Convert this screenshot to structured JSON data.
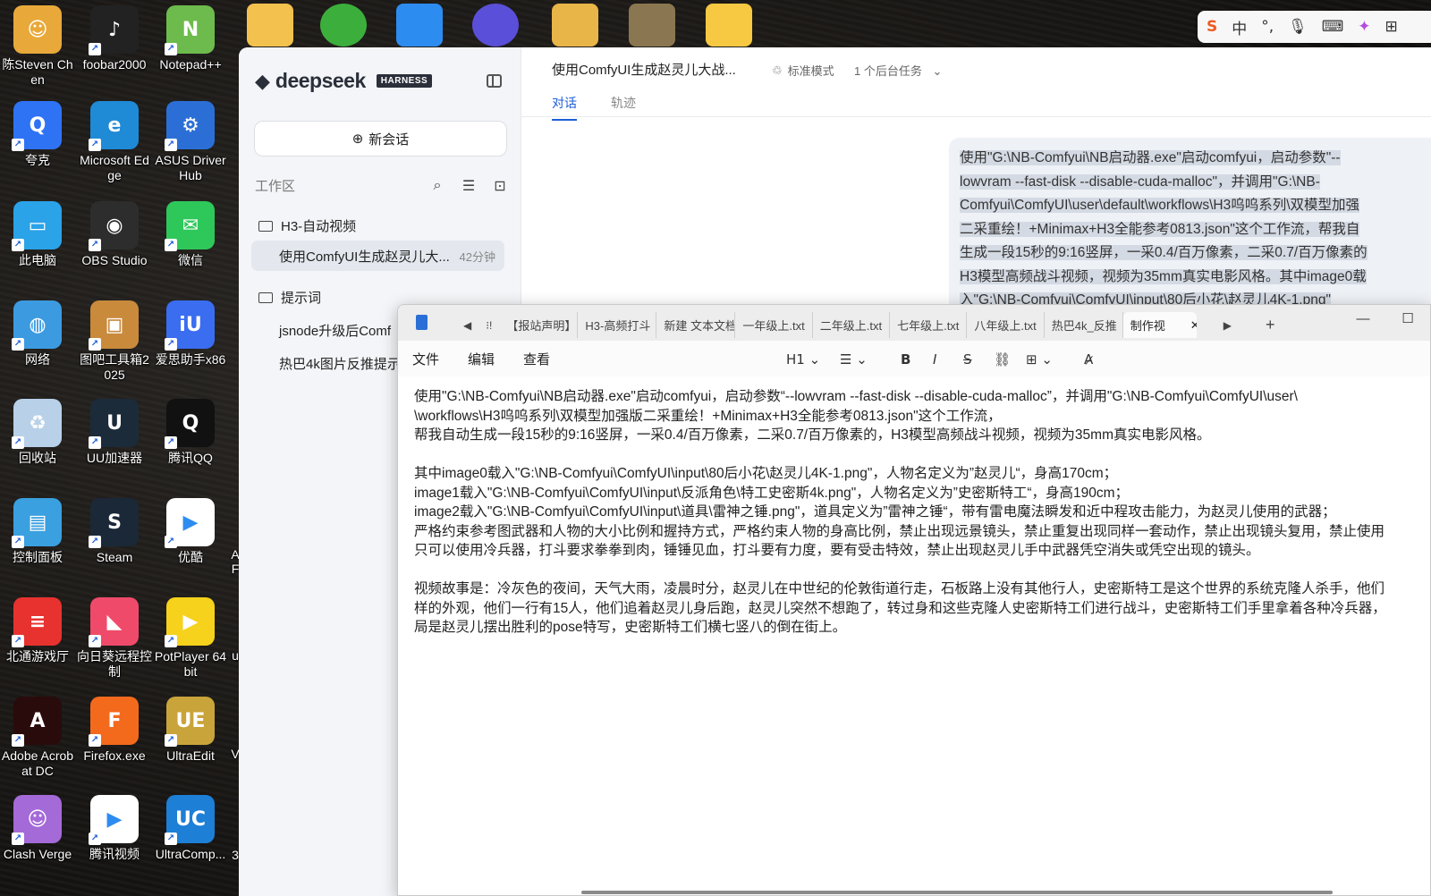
{
  "desktop": {
    "icons": [
      {
        "id": "steven",
        "label": "陈Steven Chen",
        "color": "#e8a93a",
        "glyph": "☺"
      },
      {
        "id": "foobar",
        "label": "foobar2000",
        "color": "#222222",
        "glyph": "♪"
      },
      {
        "id": "notepadpp",
        "label": "Notepad++",
        "color": "#6dbb4c",
        "glyph": "N"
      },
      {
        "id": "quark",
        "label": "夸克",
        "color": "#2f73f5",
        "glyph": "Q"
      },
      {
        "id": "edge",
        "label": "Microsoft Edge",
        "color": "#1f8ad6",
        "glyph": "e"
      },
      {
        "id": "asus",
        "label": "ASUS DriverHub",
        "color": "#2b6fd6",
        "glyph": "⚙"
      },
      {
        "id": "thispc",
        "label": "此电脑",
        "color": "#2aa3e8",
        "glyph": "▭"
      },
      {
        "id": "obs",
        "label": "OBS Studio",
        "color": "#2d2d2d",
        "glyph": "◉"
      },
      {
        "id": "wechat",
        "label": "微信",
        "color": "#2ec85a",
        "glyph": "✉"
      },
      {
        "id": "network",
        "label": "网络",
        "color": "#3c9be0",
        "glyph": "◍"
      },
      {
        "id": "tubar",
        "label": "图吧工具箱2025",
        "color": "#c98a3c",
        "glyph": "▣"
      },
      {
        "id": "aisi",
        "label": "爱思助手x86",
        "color": "#3a6df0",
        "glyph": "iU"
      },
      {
        "id": "recycle",
        "label": "回收站",
        "color": "#b8d0e8",
        "glyph": "♻"
      },
      {
        "id": "uu",
        "label": "UU加速器",
        "color": "#1c2b3a",
        "glyph": "U"
      },
      {
        "id": "qq",
        "label": "腾讯QQ",
        "color": "#111111",
        "glyph": "Q"
      },
      {
        "id": "control",
        "label": "控制面板",
        "color": "#3aa0e0",
        "glyph": "▤"
      },
      {
        "id": "steam",
        "label": "Steam",
        "color": "#1b2838",
        "glyph": "S"
      },
      {
        "id": "youku",
        "label": "优酷",
        "color": "#ffffff",
        "glyph": "▶"
      },
      {
        "id": "beitong",
        "label": "北通游戏厅",
        "color": "#e8322f",
        "glyph": "≡"
      },
      {
        "id": "sunlogin",
        "label": "向日葵远程控制",
        "color": "#f04a6a",
        "glyph": "◣"
      },
      {
        "id": "potplayer",
        "label": "PotPlayer 64 bit",
        "color": "#f6d21c",
        "glyph": "▶"
      },
      {
        "id": "acrobat",
        "label": "Adobe Acrobat DC",
        "color": "#2a0b0b",
        "glyph": "A"
      },
      {
        "id": "firefox",
        "label": "Firefox.exe",
        "color": "#f36a1d",
        "glyph": "F"
      },
      {
        "id": "ultraedit",
        "label": "UltraEdit",
        "color": "#c9a43a",
        "glyph": "UE"
      },
      {
        "id": "clash",
        "label": "Clash Verge",
        "color": "#a46ad8",
        "glyph": "☺"
      },
      {
        "id": "tencentvideo",
        "label": "腾讯视频",
        "color": "#ffffff",
        "glyph": "▶"
      },
      {
        "id": "ultracompare",
        "label": "UltraComp...",
        "color": "#1d7fd6",
        "glyph": "UC"
      }
    ],
    "partial_labels": [
      "A",
      "F",
      "3",
      "V",
      "u"
    ]
  },
  "ime": {
    "items": [
      "S",
      "中",
      "°,",
      "🎙",
      "⌨",
      "✦",
      "⊞"
    ]
  },
  "deepseek": {
    "logo_text": "deepseek",
    "badge": "HARNESS",
    "new_chat_label": "新会话",
    "workspace_label": "工作区",
    "folder1": "H3-自动视频",
    "active_session": "使用ComfyUI生成赵灵儿大...",
    "active_session_time": "42分钟",
    "folder2": "提示词",
    "item1": "jsnode升级后Comf",
    "item2": "热巴4k图片反推提示",
    "chat_title": "使用ComfyUI生成赵灵儿大战...",
    "mode": "标准模式",
    "background_task": "1 个后台任务",
    "tab_chat": "对话",
    "tab_trace": "轨迹",
    "user_message_lines": [
      "使用\"G:\\NB-Comfyui\\NB启动器.exe\"启动comfyui，启动参数\"--",
      "lowvram --fast-disk --disable-cuda-malloc\"，并调用\"G:\\NB-",
      "Comfyui\\ComfyUI\\user\\default\\workflows\\H3呜呜系列\\双模型加强",
      "二采重绘！+Minimax+H3全能参考0813.json\"这个工作流，帮我自",
      "生成一段15秒的9:16竖屏，一采0.4/百万像素，二采0.7/百万像素的",
      "H3模型高频战斗视频，视频为35mm真实电影风格。其中image0载",
      "入\"G:\\NB-Comfyui\\ComfyUI\\input\\80后小花\\赵灵儿4K-1.png\""
    ]
  },
  "notepad": {
    "tabs": [
      "【报站声明】",
      "H3-高频打斗",
      "新建 文本文档",
      "一年级上.txt",
      "二年级上.txt",
      "七年级上.txt",
      "八年级上.txt",
      "热巴4k_反推"
    ],
    "active_tab": "制作视",
    "menu": [
      "文件",
      "编辑",
      "查看"
    ],
    "heading_select": "H1",
    "lines": [
      "使用\"G:\\NB-Comfyui\\NB启动器.exe\"启动comfyui，启动参数“--lowvram --fast-disk --disable-cuda-malloc”，并调用\"G:\\NB-Comfyui\\ComfyUI\\user\\",
      "\\workflows\\H3呜呜系列\\双模型加强版二采重绘！+Minimax+H3全能参考0813.json\"这个工作流，",
      "帮我自动生成一段15秒的9:16竖屏，一采0.4/百万像素，二采0.7/百万像素的，H3模型高频战斗视频，视频为35mm真实电影风格。",
      "",
      "其中image0载入\"G:\\NB-Comfyui\\ComfyUI\\input\\80后小花\\赵灵儿4K-1.png\"，人物名定义为”赵灵儿“，身高170cm；",
      "image1载入\"G:\\NB-Comfyui\\ComfyUI\\input\\反派角色\\特工史密斯4k.png\"，人物名定义为”史密斯特工“，身高190cm；",
      "image2载入\"G:\\NB-Comfyui\\ComfyUI\\input\\道具\\雷神之锤.png\"，道具定义为”雷神之锤“，带有雷电魔法瞬发和近中程攻击能力，为赵灵儿使用的武器；",
      "严格约束参考图武器和人物的大小比例和握持方式，严格约束人物的身高比例，禁止出现远景镜头，禁止重复出现同样一套动作，禁止出现镜头复用，禁止使用",
      "只可以使用冷兵器，打斗要求拳拳到肉，锤锤见血，打斗要有力度，要有受击特效，禁止出现赵灵儿手中武器凭空消失或凭空出现的镜头。",
      "",
      "视频故事是：冷灰色的夜间，天气大雨，凌晨时分，赵灵儿在中世纪的伦敦街道行走，石板路上没有其他行人，史密斯特工是这个世界的系统克隆人杀手，他们",
      "样的外观，他们一行有15人，他们追着赵灵儿身后跑，赵灵儿突然不想跑了，转过身和这些克隆人史密斯特工们进行战斗，史密斯特工们手里拿着各种冷兵器，",
      "局是赵灵儿摆出胜利的pose特写，史密斯特工们横七竖八的倒在街上。"
    ]
  }
}
